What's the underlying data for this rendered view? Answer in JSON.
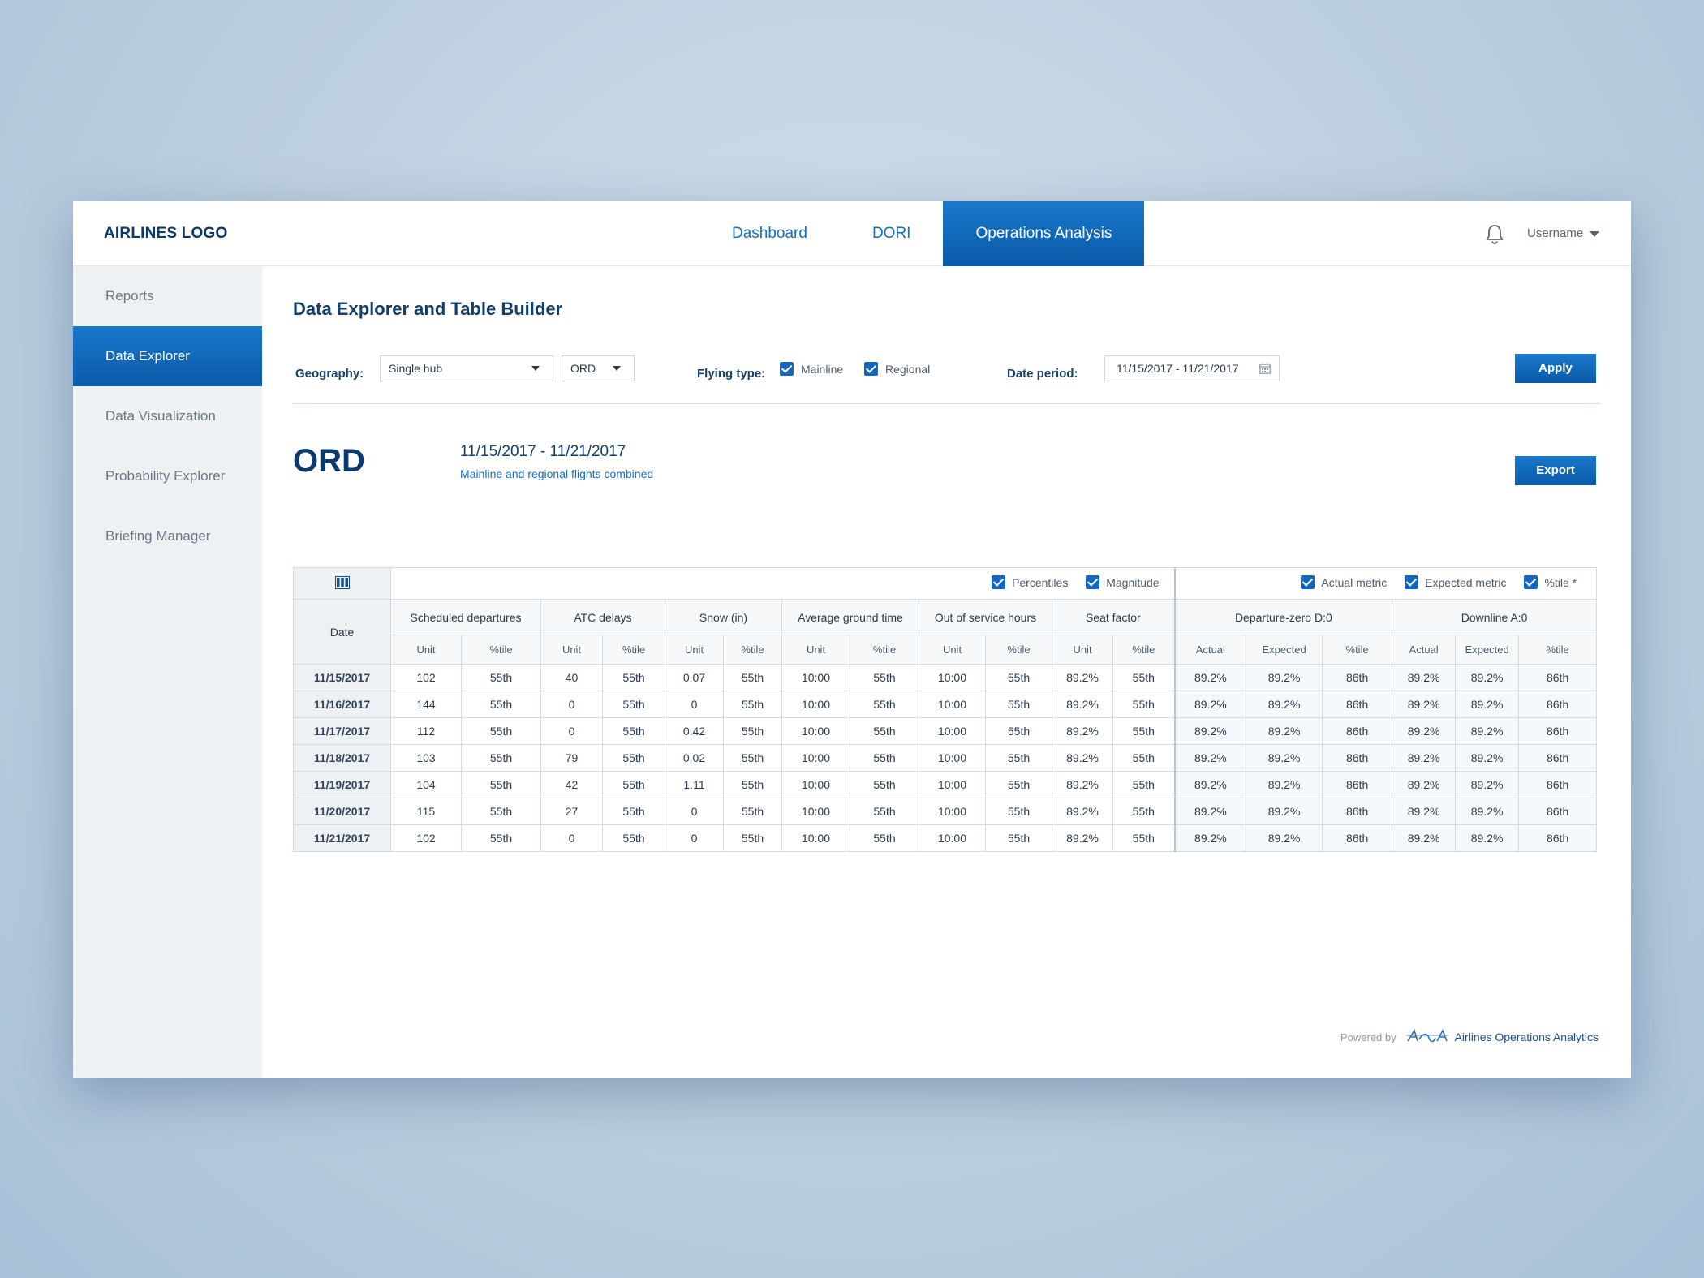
{
  "header": {
    "logo": "AIRLINES LOGO",
    "tabs": [
      {
        "label": "Dashboard",
        "active": false
      },
      {
        "label": "DORI",
        "active": false
      },
      {
        "label": "Operations Analysis",
        "active": true
      }
    ],
    "username": "Username"
  },
  "sidebar": {
    "items": [
      {
        "label": "Reports",
        "active": false
      },
      {
        "label": "Data Explorer",
        "active": true
      },
      {
        "label": "Data Visualization",
        "active": false
      },
      {
        "label": "Probability Explorer",
        "active": false
      },
      {
        "label": "Briefing Manager",
        "active": false
      }
    ]
  },
  "page": {
    "title": "Data Explorer and Table Builder"
  },
  "filters": {
    "geography_label": "Geography:",
    "geography_value": "Single hub",
    "hub_value": "ORD",
    "flying_type_label": "Flying type:",
    "mainline_label": "Mainline",
    "regional_label": "Regional",
    "date_period_label": "Date period:",
    "date_period_value": "11/15/2017 - 11/21/2017",
    "apply_label": "Apply"
  },
  "summary": {
    "hub": "ORD",
    "range": "11/15/2017 - 11/21/2017",
    "subline": "Mainline  and regional flights combined",
    "export_label": "Export"
  },
  "table": {
    "toggles_left": [
      "Percentiles",
      "Magnitude"
    ],
    "toggles_right": [
      "Actual metric",
      "Expected metric",
      "%tile *"
    ],
    "date_header": "Date",
    "groups": [
      {
        "label": "Scheduled departures",
        "subs": [
          "Unit",
          "%tile"
        ]
      },
      {
        "label": "ATC delays",
        "subs": [
          "Unit",
          "%tile"
        ]
      },
      {
        "label": "Snow (in)",
        "subs": [
          "Unit",
          "%tile"
        ]
      },
      {
        "label": "Average ground time",
        "subs": [
          "Unit",
          "%tile"
        ]
      },
      {
        "label": "Out of service hours",
        "subs": [
          "Unit",
          "%tile"
        ]
      },
      {
        "label": "Seat factor",
        "subs": [
          "Unit",
          "%tile"
        ]
      },
      {
        "label": "Departure-zero D:0",
        "subs": [
          "Actual",
          "Expected",
          "%tile"
        ]
      },
      {
        "label": "Downline A:0",
        "subs": [
          "Actual",
          "Expected",
          "%tile"
        ]
      }
    ],
    "rows": [
      [
        "11/15/2017",
        "102",
        "55th",
        "40",
        "55th",
        "0.07",
        "55th",
        "10:00",
        "55th",
        "10:00",
        "55th",
        "89.2%",
        "55th",
        "89.2%",
        "89.2%",
        "86th",
        "89.2%",
        "89.2%",
        "86th"
      ],
      [
        "11/16/2017",
        "144",
        "55th",
        "0",
        "55th",
        "0",
        "55th",
        "10:00",
        "55th",
        "10:00",
        "55th",
        "89.2%",
        "55th",
        "89.2%",
        "89.2%",
        "86th",
        "89.2%",
        "89.2%",
        "86th"
      ],
      [
        "11/17/2017",
        "112",
        "55th",
        "0",
        "55th",
        "0.42",
        "55th",
        "10:00",
        "55th",
        "10:00",
        "55th",
        "89.2%",
        "55th",
        "89.2%",
        "89.2%",
        "86th",
        "89.2%",
        "89.2%",
        "86th"
      ],
      [
        "11/18/2017",
        "103",
        "55th",
        "79",
        "55th",
        "0.02",
        "55th",
        "10:00",
        "55th",
        "10:00",
        "55th",
        "89.2%",
        "55th",
        "89.2%",
        "89.2%",
        "86th",
        "89.2%",
        "89.2%",
        "86th"
      ],
      [
        "11/19/2017",
        "104",
        "55th",
        "42",
        "55th",
        "1.11",
        "55th",
        "10:00",
        "55th",
        "10:00",
        "55th",
        "89.2%",
        "55th",
        "89.2%",
        "89.2%",
        "86th",
        "89.2%",
        "89.2%",
        "86th"
      ],
      [
        "11/20/2017",
        "115",
        "55th",
        "27",
        "55th",
        "0",
        "55th",
        "10:00",
        "55th",
        "10:00",
        "55th",
        "89.2%",
        "55th",
        "89.2%",
        "89.2%",
        "86th",
        "89.2%",
        "89.2%",
        "86th"
      ],
      [
        "11/21/2017",
        "102",
        "55th",
        "0",
        "55th",
        "0",
        "55th",
        "10:00",
        "55th",
        "10:00",
        "55th",
        "89.2%",
        "55th",
        "89.2%",
        "89.2%",
        "86th",
        "89.2%",
        "89.2%",
        "86th"
      ]
    ]
  },
  "footer": {
    "powered_by": "Powered by",
    "brand": "Airlines Operations Analytics"
  },
  "colors": {
    "accent": "#1470c5",
    "accent_dark": "#0a5aa8",
    "navy": "#0b3a6e",
    "sidebar_bg": "#eef1f4"
  },
  "icons": {
    "bell": "bell-icon",
    "columns": "columns-icon",
    "calendar": "calendar-icon",
    "dropdown": "chevron-down-icon"
  }
}
